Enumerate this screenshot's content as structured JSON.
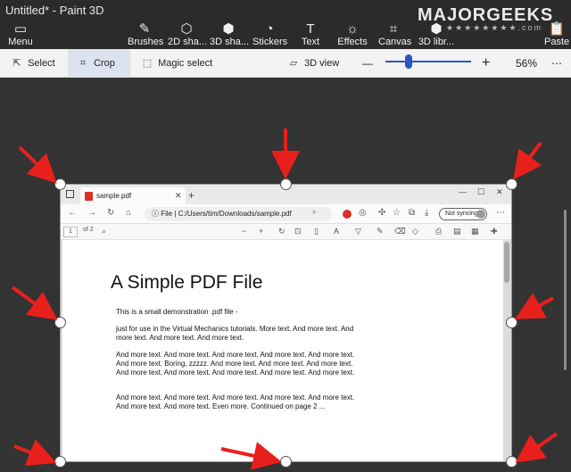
{
  "window": {
    "title": "Untitled* - Paint 3D"
  },
  "watermark": {
    "text": "MAJORGEEKS",
    "stars": "★★★★★★★★.com"
  },
  "ribbon": {
    "menu": "Menu",
    "brushes": "Brushes",
    "shapes2d": "2D sha...",
    "shapes3d": "3D sha...",
    "stickers": "Stickers",
    "text": "Text",
    "effects": "Effects",
    "canvas": "Canvas",
    "library3d": "3D libr...",
    "paste": "Paste"
  },
  "toolbar": {
    "select": "Select",
    "crop": "Crop",
    "magic_select": "Magic select",
    "view3d": "3D view",
    "zoom_minus": "—",
    "zoom_plus": "+",
    "zoom_level": "56%",
    "more": "⋯"
  },
  "colors": {
    "accent": "#2a56c6",
    "arrow": "#e8201c",
    "ribbon_bg": "#2b2b2b",
    "canvas_bg": "#333333"
  },
  "browser": {
    "tab_title": "sample.pdf",
    "tab_close": "✕",
    "new_tab": "+",
    "file_label": "File",
    "url": "C:/Users/tim/Downloads/sample.pdf",
    "sync": "Not syncing",
    "page_num": "1",
    "page_of": "of 2",
    "win_min": "—",
    "win_max": "☐",
    "win_close": "✕"
  },
  "pdf": {
    "title": "A Simple PDF File",
    "p1": "This is a small demonstration .pdf file -",
    "p2": "just for use in the Virtual Mechanics tutorials. More text. And more text. And more text. And more text. And more text.",
    "p3": "And more text. And more text. And more text. And more text. And more text. And more text. Boring, zzzzz. And more text. And more text. And more text. And more text. And more text. And more text. And more text. And more text.",
    "p4": "And more text. And more text. And more text. And more text. And more text. And more text. And more text. Even more. Continued on page 2 ..."
  }
}
